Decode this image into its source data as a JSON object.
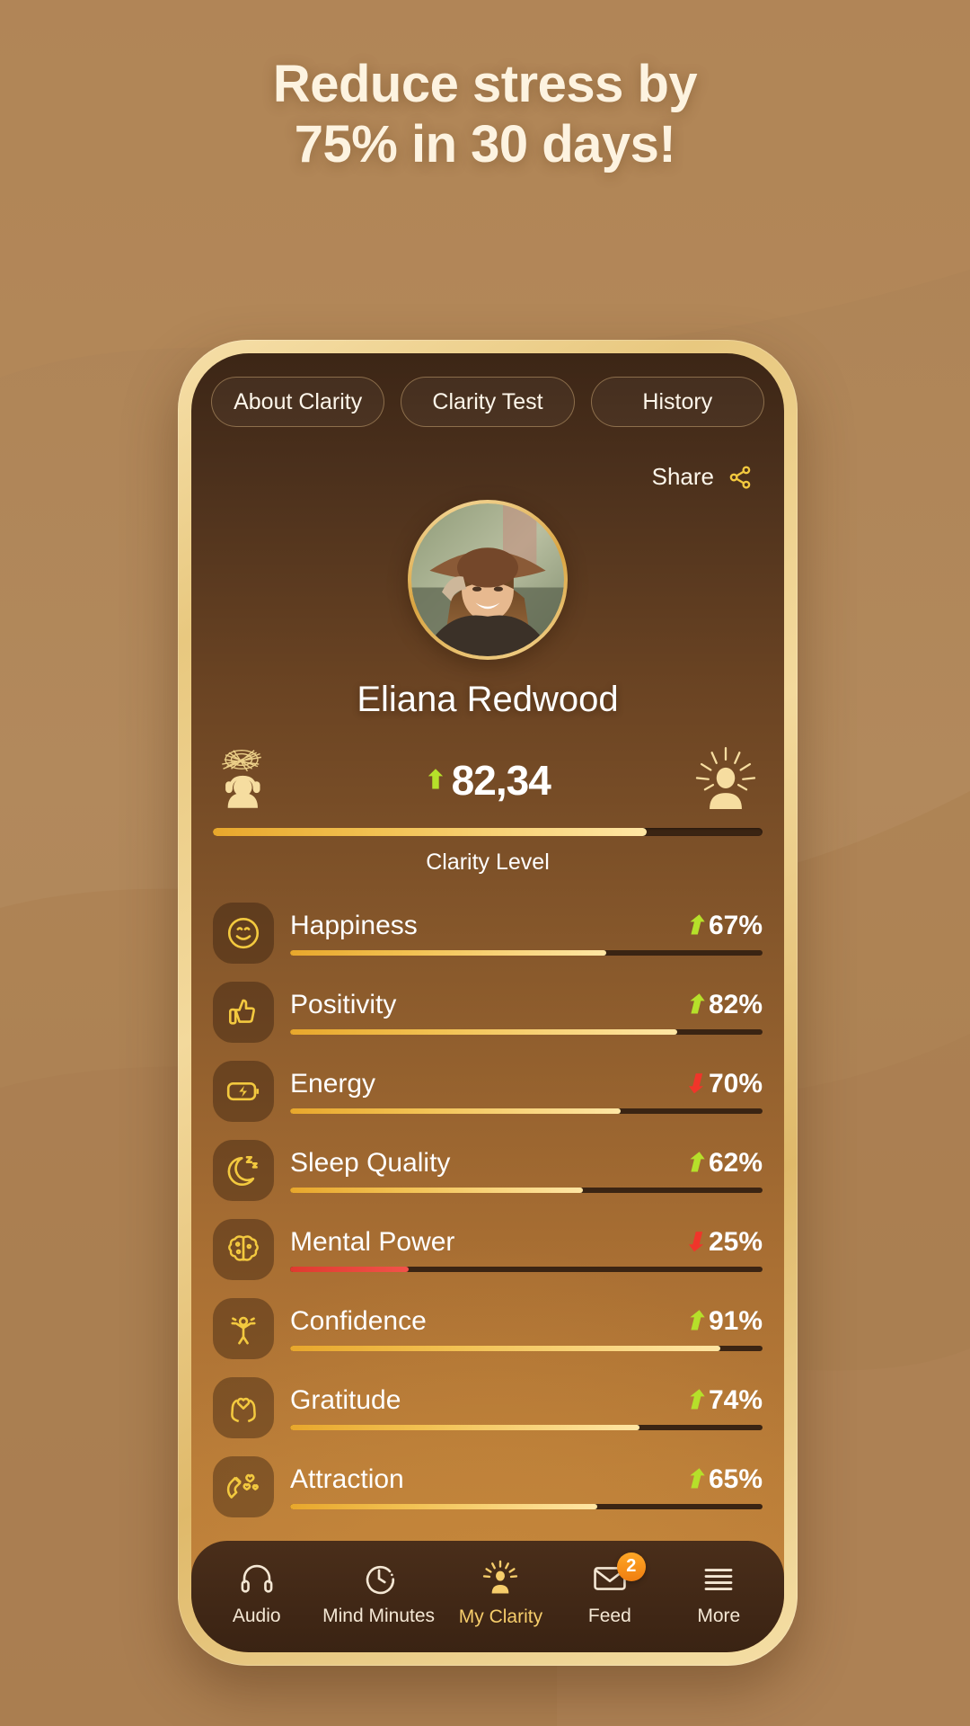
{
  "headline": {
    "line1": "Reduce stress by",
    "line2": "75% in 30 days!"
  },
  "tabs": [
    {
      "label": "About Clarity",
      "active": false
    },
    {
      "label": "Clarity Test",
      "active": false
    },
    {
      "label": "History",
      "active": false
    }
  ],
  "share": {
    "label": "Share",
    "icon": "share-icon"
  },
  "profile": {
    "name": "Eliana Redwood",
    "avatar_alt": "smiling woman wearing a wide-brim hat"
  },
  "clarity": {
    "score": "82,34",
    "trend": "up",
    "label": "Clarity Level",
    "percent": 79,
    "left_icon": "stressed-person-icon",
    "right_icon": "enlightened-person-icon"
  },
  "colors": {
    "gold": "#f2c152",
    "gold_light": "#ffe6a4",
    "up_green": "#b6e02a",
    "down_red": "#f0352a",
    "track": "#3a2413",
    "background_sand": "#b08457",
    "badge_orange": "#f07e10"
  },
  "chart_data": {
    "type": "bar",
    "title": "Clarity Level",
    "xlabel": "",
    "ylabel": "Percent",
    "ylim": [
      0,
      100
    ],
    "categories": [
      "Happiness",
      "Positivity",
      "Energy",
      "Sleep Quality",
      "Mental Power",
      "Confidence",
      "Gratitude",
      "Attraction"
    ],
    "values": [
      67,
      82,
      70,
      62,
      25,
      91,
      74,
      65
    ],
    "trends": [
      "up",
      "up",
      "down",
      "up",
      "down",
      "up",
      "up",
      "up"
    ],
    "overall": {
      "label": "Clarity Level",
      "value": "82,34",
      "percent": 79,
      "trend": "up"
    }
  },
  "metrics": [
    {
      "name": "Happiness",
      "value": "67%",
      "percent": 67,
      "trend": "up",
      "icon": "smiley-face-icon"
    },
    {
      "name": "Positivity",
      "value": "82%",
      "percent": 82,
      "trend": "up",
      "icon": "thumbs-up-icon"
    },
    {
      "name": "Energy",
      "value": "70%",
      "percent": 70,
      "trend": "down",
      "icon": "battery-bolt-icon"
    },
    {
      "name": "Sleep Quality",
      "value": "62%",
      "percent": 62,
      "trend": "up",
      "icon": "moon-sleep-icon"
    },
    {
      "name": "Mental Power",
      "value": "25%",
      "percent": 25,
      "trend": "down",
      "icon": "brain-icon"
    },
    {
      "name": "Confidence",
      "value": "91%",
      "percent": 91,
      "trend": "up",
      "icon": "person-arms-up-icon"
    },
    {
      "name": "Gratitude",
      "value": "74%",
      "percent": 74,
      "trend": "up",
      "icon": "hands-heart-icon"
    },
    {
      "name": "Attraction",
      "value": "65%",
      "percent": 65,
      "trend": "up",
      "icon": "magnet-hearts-icon"
    }
  ],
  "bottom_nav": [
    {
      "label": "Audio",
      "icon": "headphones-icon",
      "active": false,
      "badge": null
    },
    {
      "label": "Mind Minutes",
      "icon": "clock-icon",
      "active": false,
      "badge": null
    },
    {
      "label": "My Clarity",
      "icon": "sun-person-icon",
      "active": true,
      "badge": null
    },
    {
      "label": "Feed",
      "icon": "envelope-icon",
      "active": false,
      "badge": "2"
    },
    {
      "label": "More",
      "icon": "hamburger-icon",
      "active": false,
      "badge": null
    }
  ]
}
